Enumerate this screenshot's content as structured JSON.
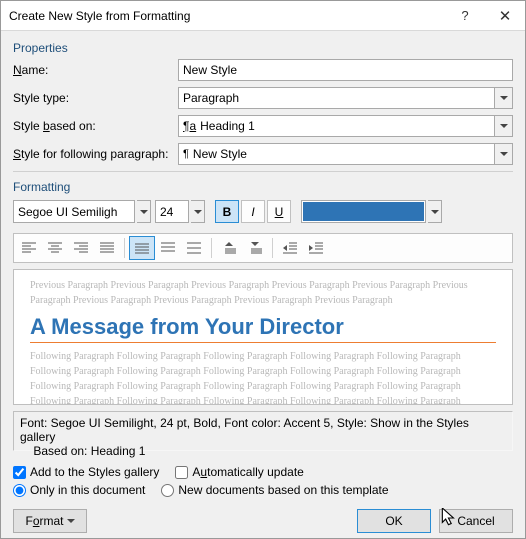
{
  "title": "Create New Style from Formatting",
  "properties": {
    "section": "Properties",
    "name_label": "Name:",
    "name_value": "New Style",
    "styletype_label": "Style type:",
    "styletype_value": "Paragraph",
    "basedon_label": "Style based on:",
    "basedon_value": "Heading 1",
    "following_label": "Style for following paragraph:",
    "following_value": "New Style"
  },
  "formatting": {
    "section": "Formatting",
    "font_name": "Segoe UI Semiligh",
    "font_size": "24",
    "bold": "B",
    "italic": "I",
    "underline": "U",
    "swatch_color": "#2e74b5"
  },
  "preview": {
    "ghost_prev": "Previous Paragraph Previous Paragraph Previous Paragraph Previous Paragraph Previous Paragraph Previous Paragraph Previous Paragraph Previous Paragraph Previous Paragraph Previous Paragraph",
    "sample": "A Message from Your Director",
    "ghost_next": "Following Paragraph Following Paragraph Following Paragraph Following Paragraph Following Paragraph Following Paragraph Following Paragraph Following Paragraph Following Paragraph Following Paragraph Following Paragraph Following Paragraph Following Paragraph Following Paragraph Following Paragraph Following Paragraph Following Paragraph Following Paragraph Following Paragraph Following Paragraph"
  },
  "description": {
    "line1": "Font: Segoe UI Semilight, 24 pt, Bold, Font color: Accent 5, Style: Show in the Styles gallery",
    "line2": "    Based on: Heading 1"
  },
  "options": {
    "add_gallery": "Add to the Styles gallery",
    "auto_update": "Automatically update",
    "only_doc": "Only in this document",
    "new_template": "New documents based on this template"
  },
  "buttons": {
    "format": "Format",
    "ok": "OK",
    "cancel": "Cancel"
  }
}
